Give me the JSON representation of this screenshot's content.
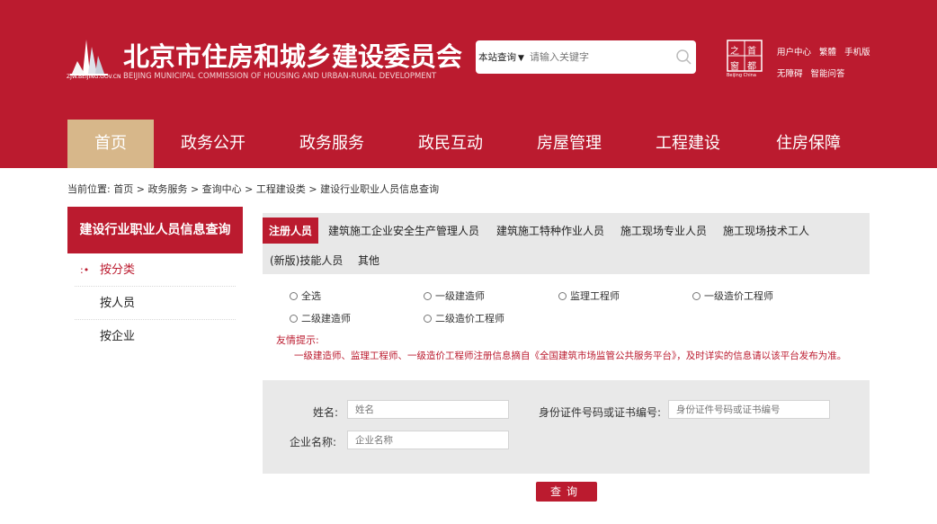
{
  "header": {
    "site_title": "北京市住房和城乡建设委员会",
    "site_subtitle": "BEIJING MUNICIPAL COMMISSION OF HOUSING AND URBAN-RURAL DEVELOPMENT",
    "logo_url_text": "ZJW.BEIJING.GOV.CN",
    "search": {
      "scope_label": "本站查询",
      "placeholder": "请输入关键字"
    },
    "seal": {
      "chars": [
        "之",
        "首",
        "窗",
        "都"
      ],
      "caption": "Beijing China"
    },
    "links": [
      "用户中心",
      "繁體",
      "手机版",
      "无障碍",
      "智能问答"
    ]
  },
  "nav": {
    "items": [
      "首页",
      "政务公开",
      "政务服务",
      "政民互动",
      "房屋管理",
      "工程建设",
      "住房保障"
    ],
    "active_index": 0
  },
  "breadcrumb": {
    "prefix": "当前位置:",
    "items": [
      "首页",
      "政务服务",
      "查询中心",
      "工程建设类",
      "建设行业职业人员信息查询"
    ],
    "separator": ">"
  },
  "sidebar": {
    "title": "建设行业职业人员信息查询",
    "items": [
      "按分类",
      "按人员",
      "按企业"
    ],
    "active_index": 0
  },
  "tabs": {
    "items": [
      "注册人员",
      "建筑施工企业安全生产管理人员",
      "建筑施工特种作业人员",
      "施工现场专业人员",
      "施工现场技术工人",
      "(新版)技能人员",
      "其他"
    ],
    "active_index": 0
  },
  "filters": {
    "options": [
      "全选",
      "一级建造师",
      "监理工程师",
      "一级造价工程师",
      "二级建造师",
      "二级造价工程师"
    ]
  },
  "notice": {
    "title": "友情提示:",
    "body": "一级建造师、监理工程师、一级造价工程师注册信息摘自《全国建筑市场监管公共服务平台》，及时详实的信息请以该平台发布为准。"
  },
  "form": {
    "name_label": "姓名:",
    "name_placeholder": "姓名",
    "id_label": "身份证件号码或证书编号:",
    "id_placeholder": "身份证件号码或证书编号",
    "company_label": "企业名称:",
    "company_placeholder": "企业名称",
    "submit_label": "查询"
  },
  "colors": {
    "brand_red": "#bb1b2f",
    "nav_active": "#d7b78a"
  }
}
